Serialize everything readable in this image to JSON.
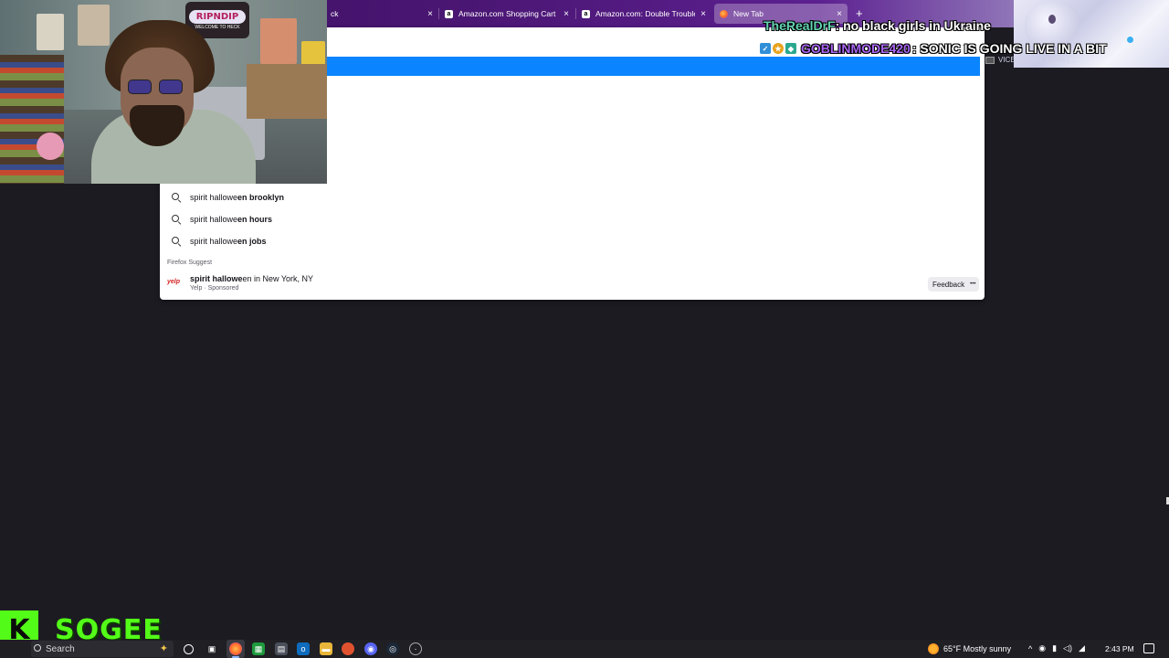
{
  "browser": {
    "tabs": [
      {
        "title": "ck",
        "favicon": "amazon-icon",
        "active": false
      },
      {
        "title": "Amazon.com Shopping Cart",
        "favicon": "amazon-icon",
        "active": false
      },
      {
        "title": "Amazon.com: Double Trouble P",
        "favicon": "amazon-icon",
        "active": false
      },
      {
        "title": "New Tab",
        "favicon": "firefox-icon",
        "active": true
      }
    ],
    "close_glyph": "×",
    "new_tab_glyph": "+"
  },
  "url_dropdown": {
    "highlight_color": "#0a84ff",
    "go_glyph": "→",
    "suggestions": [
      {
        "prefix": "spirit hallowe",
        "bold": "en brooklyn"
      },
      {
        "prefix": "spirit hallowe",
        "bold": "en hours"
      },
      {
        "prefix": "spirit hallowe",
        "bold": "en jobs"
      }
    ],
    "group_label": "Firefox Suggest",
    "sponsored": {
      "logo_text": "yelp",
      "title_bold": "spirit hallowe",
      "title_rest": "en in New York, NY",
      "subtitle": "Yelp · Sponsored",
      "feedback_label": "Feedback",
      "more_glyph": "•••"
    },
    "side_result": {
      "text": "VICE | United States | ..."
    }
  },
  "webcam": {
    "sign_text": "RIPNDIP",
    "sign_sub": "WELCOME TO HECK"
  },
  "chat": [
    {
      "user": "TheRealDrF",
      "message": ": no black girls in Ukraine"
    },
    {
      "user": "GOBLINMODE420",
      "message": ": SONIC IS GOING LIVE IN A BIT"
    }
  ],
  "streamer": {
    "logo": "K",
    "name": "SOGEE",
    "accent": "#53fc18"
  },
  "taskbar": {
    "search_placeholder": "Search",
    "weather": "65°F  Mostly sunny",
    "clock": "2:43 PM"
  }
}
